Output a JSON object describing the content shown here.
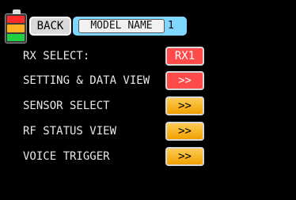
{
  "header": {
    "back_label": "BACK",
    "model_name_label": "MODEL NAME",
    "model_number": "1"
  },
  "rows": [
    {
      "label": "RX SELECT:",
      "value": "RX1"
    },
    {
      "label": "SETTING & DATA VIEW",
      "value": ">>"
    },
    {
      "label": "SENSOR SELECT",
      "value": ">>"
    },
    {
      "label": "RF STATUS VIEW",
      "value": ">>"
    },
    {
      "label": "VOICE TRIGGER",
      "value": ">>"
    }
  ],
  "battery": {
    "segments": [
      "red",
      "orange",
      "green"
    ]
  },
  "colors": {
    "background": "#000000",
    "rx_button": "#ff4a4a",
    "arrow_button": "#f5b000",
    "model_box": "#7fd6ff"
  }
}
